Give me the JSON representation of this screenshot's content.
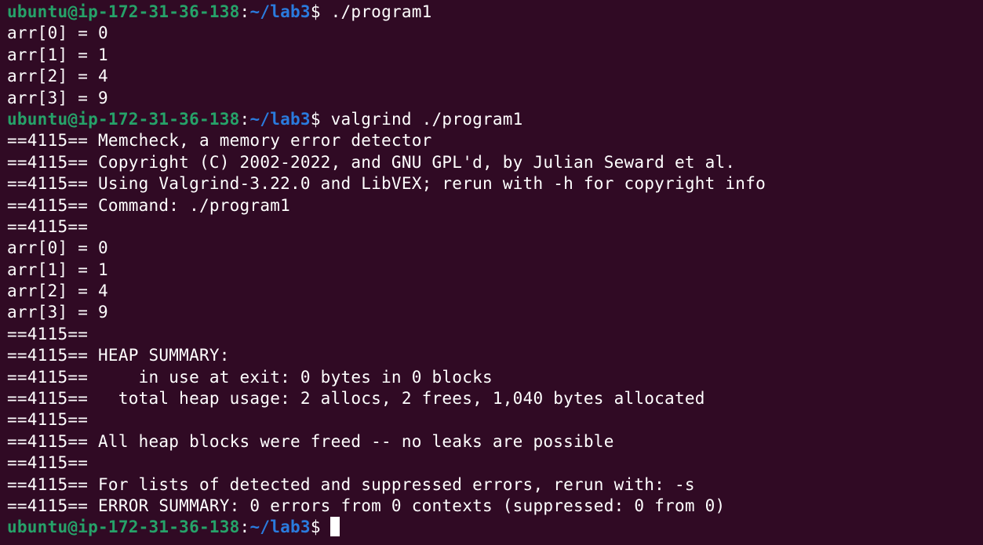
{
  "prompt": {
    "user_host": "ubuntu@ip-172-31-36-138",
    "separator": ":",
    "path": "~/lab3",
    "symbol": "$"
  },
  "commands": [
    " ./program1",
    " valgrind ./program1"
  ],
  "program_output_1": [
    "arr[0] = 0",
    "arr[1] = 1",
    "arr[2] = 4",
    "arr[3] = 9"
  ],
  "valgrind_output": [
    "==4115== Memcheck, a memory error detector",
    "==4115== Copyright (C) 2002-2022, and GNU GPL'd, by Julian Seward et al.",
    "==4115== Using Valgrind-3.22.0 and LibVEX; rerun with -h for copyright info",
    "==4115== Command: ./program1",
    "==4115==",
    "arr[0] = 0",
    "arr[1] = 1",
    "arr[2] = 4",
    "arr[3] = 9",
    "==4115==",
    "==4115== HEAP SUMMARY:",
    "==4115==     in use at exit: 0 bytes in 0 blocks",
    "==4115==   total heap usage: 2 allocs, 2 frees, 1,040 bytes allocated",
    "==4115==",
    "==4115== All heap blocks were freed -- no leaks are possible",
    "==4115==",
    "==4115== For lists of detected and suppressed errors, rerun with: -s",
    "==4115== ERROR SUMMARY: 0 errors from 0 contexts (suppressed: 0 from 0)"
  ],
  "colors": {
    "background": "#300a24",
    "text": "#ffffff",
    "prompt_user": "#26a269",
    "prompt_path": "#2a7bde"
  }
}
